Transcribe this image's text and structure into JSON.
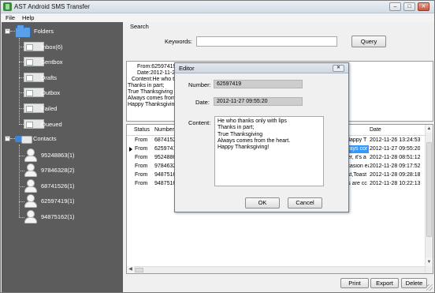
{
  "window": {
    "title": "AST Android SMS Transfer",
    "controls": {
      "minimize": "–",
      "maximize": "□",
      "close": "✕"
    }
  },
  "menu": [
    "File",
    "Help"
  ],
  "sidebar": {
    "folders_label": "Folders",
    "folders": [
      {
        "label": "Inbox(6)",
        "icon": "message-icon"
      },
      {
        "label": "Sentbox",
        "icon": "message-icon"
      },
      {
        "label": "Drafts",
        "icon": "message-icon"
      },
      {
        "label": "Outbox",
        "icon": "message-icon"
      },
      {
        "label": "Failed",
        "icon": "message-icon"
      },
      {
        "label": "Queued",
        "icon": "message-icon"
      }
    ],
    "contacts_label": "Contacts",
    "contacts": [
      {
        "label": "95248863(1)"
      },
      {
        "label": "97846328(2)"
      },
      {
        "label": "68741526(1)"
      },
      {
        "label": "62597419(1)"
      },
      {
        "label": "94875162(1)"
      }
    ]
  },
  "search": {
    "heading": "Search",
    "keywords_label": "Keywords:",
    "keywords_value": "",
    "query_button": "Query"
  },
  "preview": {
    "from_line": "From:62597419",
    "date_line": "Date:2012-11-27",
    "content_line": "Content:He who th",
    "body_lines": [
      "Thanks in part;",
      "True Thanksgiving",
      "Always comes from",
      "Happy Thanksgiving"
    ]
  },
  "table": {
    "columns": [
      "Status",
      "Number",
      "Date"
    ],
    "rows": [
      {
        "status": "From",
        "number": "68741526",
        "snippet": ",Happy T",
        "date": "2012-11-26 13:24:53",
        "current": false,
        "selected": false
      },
      {
        "status": "From",
        "number": "62597419",
        "snippet": "lways cor",
        "date": "2012-11-27 09:55:20",
        "current": true,
        "selected": true
      },
      {
        "status": "From",
        "number": "95248863",
        "snippet": "per, it's a",
        "date": "2012-11-28 08:51:12",
        "current": false,
        "selected": false
      },
      {
        "status": "From",
        "number": "97846328",
        "snippet": "ccasion ea",
        "date": "2012-11-28 09:17:52",
        "current": false,
        "selected": false
      },
      {
        "status": "From",
        "number": "94875162",
        "snippet": "ast,Toast",
        "date": "2012-11-28 09:28:18",
        "current": false,
        "selected": false
      },
      {
        "status": "From",
        "number": "94875162",
        "snippet": "rts are cc",
        "date": "2012-11-28 10:22:13",
        "current": false,
        "selected": false
      }
    ]
  },
  "actions": {
    "print": "Print",
    "export": "Export",
    "delete": "Delete"
  },
  "dialog": {
    "title": "Editor",
    "close": "✕",
    "number_label": "Number:",
    "number_value": "62597419",
    "date_label": "Date:",
    "date_value": "2012-11-27 09:55:20",
    "content_label": "Content:",
    "content_value": "He who thanks only with lips\nThanks in part;\nTrue Thanksgiving\nAlways comes from the heart.\nHappy Thanksgiving!",
    "ok": "OK",
    "cancel": "Cancel"
  },
  "colors": {
    "sidebar_bg": "#5c5c5c",
    "selection": "#3399ff",
    "readonly_field": "#cdcdcd"
  }
}
